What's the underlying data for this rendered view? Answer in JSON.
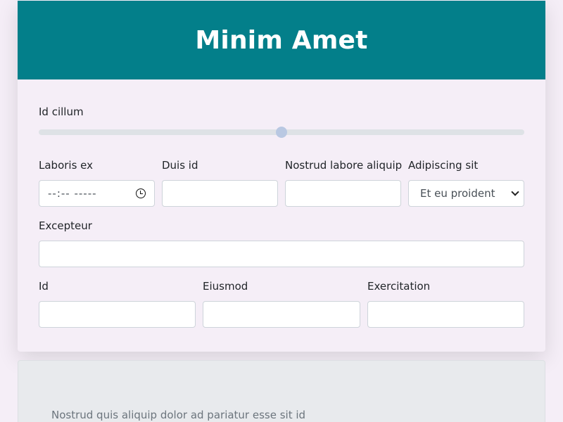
{
  "header": {
    "title": "Minim Amet"
  },
  "range": {
    "label": "Id cillum",
    "value_fraction": 0.5
  },
  "row1": {
    "f1": {
      "label": "Laboris ex",
      "placeholder": "--:-- -----"
    },
    "f2": {
      "label": "Duis id",
      "value": ""
    },
    "f3": {
      "label": "Nostrud labore aliquip",
      "value": ""
    },
    "f4": {
      "label": "Adipiscing sit",
      "selected": "Et eu proident"
    }
  },
  "row2": {
    "f1": {
      "label": "Excepteur",
      "value": ""
    }
  },
  "row3": {
    "f1": {
      "label": "Id",
      "value": ""
    },
    "f2": {
      "label": "Eiusmod",
      "value": ""
    },
    "f3": {
      "label": "Exercitation",
      "value": ""
    }
  },
  "panel": {
    "text": "Nostrud quis aliquip dolor ad pariatur esse sit id"
  },
  "colors": {
    "header_bg": "#037f8a",
    "page_bg": "#f5eef7"
  }
}
